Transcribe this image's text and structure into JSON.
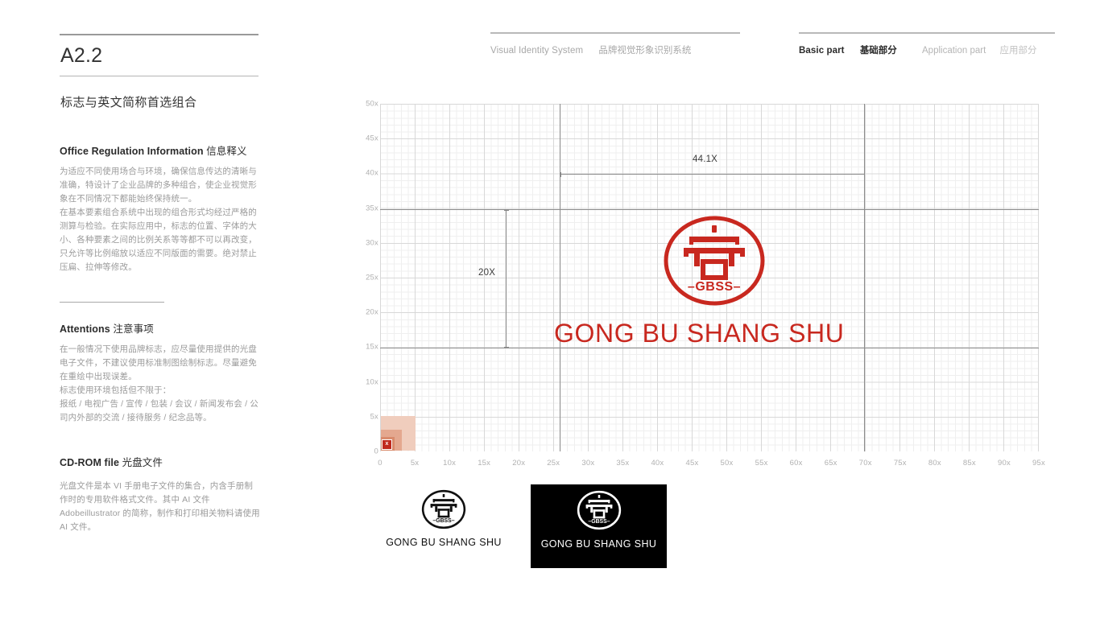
{
  "page": {
    "code": "A2.2",
    "subtitle": "标志与英文简称首选组合"
  },
  "header": {
    "left": {
      "en": "Visual Identity System",
      "cn": "品牌视觉形象识别系统"
    },
    "right": {
      "active_en": "Basic part",
      "active_cn": "基础部分",
      "inactive_en": "Application part",
      "inactive_cn": "应用部分"
    }
  },
  "sections": [
    {
      "heading_en": "Office Regulation Information",
      "heading_cn": "信息释义",
      "paragraphs": [
        "为适应不同使用场合与环境，确保信息传达的清晰与准确，特设计了企业品牌的多种组合，使企业视觉形象在不同情况下都能始终保持统一。",
        "在基本要素组合系统中出现的组合形式均经过严格的测算与检验。在实际应用中，标志的位置、字体的大小、各种要素之间的比例关系等等都不可以再改变，只允许等比例缩放以适应不同版面的需要。绝对禁止压扁、拉伸等修改。"
      ]
    },
    {
      "heading_en": "Attentions",
      "heading_cn": "注意事项",
      "paragraphs": [
        "在一般情况下使用品牌标志，应尽量使用提供的光盘电子文件，不建议使用标准制图绘制标志。尽量避免在重绘中出现误差。",
        "标志使用环境包括但不限于：",
        "报纸 / 电视广告 / 宣传 / 包装 / 会议 / 新闻发布会 / 公司内外部的交流 / 接待服务 / 纪念品等。"
      ]
    },
    {
      "heading_en": "CD-ROM file",
      "heading_cn": "光盘文件",
      "paragraphs": [
        "光盘文件是本 VI 手册电子文件的集合，内含手册制作时的专用软件格式文件。其中 AI 文件 Adobeillustrator 的简称，制作和打印相关物料请使用 AI 文件。"
      ]
    }
  ],
  "chart_data": {
    "type": "scatter",
    "title": "",
    "xlabel": "",
    "ylabel": "",
    "xlim": [
      0,
      95
    ],
    "ylim": [
      0,
      50
    ],
    "grid": true,
    "x_ticks": [
      "0",
      "5x",
      "10x",
      "15x",
      "20x",
      "25x",
      "30x",
      "35x",
      "40x",
      "45x",
      "50x",
      "55x",
      "60x",
      "65x",
      "70x",
      "75x",
      "80x",
      "85x",
      "90x",
      "95x"
    ],
    "x_tick_values": [
      0,
      5,
      10,
      15,
      20,
      25,
      30,
      35,
      40,
      45,
      50,
      55,
      60,
      65,
      70,
      75,
      80,
      85,
      90,
      95
    ],
    "y_ticks": [
      "0",
      "5x",
      "10x",
      "15x",
      "20x",
      "25x",
      "30x",
      "35x",
      "40x",
      "45x",
      "50x"
    ],
    "y_tick_values": [
      0,
      5,
      10,
      15,
      20,
      25,
      30,
      35,
      40,
      45,
      50
    ],
    "minor_grid_step": 1,
    "major_grid_step": 5,
    "reference_lines": [
      {
        "orientation": "horizontal",
        "value": 35
      },
      {
        "orientation": "horizontal",
        "value": 15
      },
      {
        "orientation": "vertical",
        "value": 25
      },
      {
        "orientation": "vertical",
        "value": 70
      }
    ],
    "annotations": [
      {
        "label": "44.1X",
        "orientation": "horizontal",
        "from": 25,
        "to": 70,
        "at": 40
      },
      {
        "label": "20X",
        "orientation": "vertical",
        "from": 15,
        "to": 35,
        "at": 18
      }
    ],
    "unit_swatches": [
      {
        "size": 5,
        "color": "#f0cdbd"
      },
      {
        "size": 3,
        "color": "#e4a88f"
      },
      {
        "size": 2,
        "color": "#d98b6c"
      },
      {
        "size": 1,
        "color": "#c0291d",
        "label": "x"
      }
    ]
  },
  "logo": {
    "ring_label": "GBSS",
    "ring_label_display": "–GBSS–",
    "glyph": "尚",
    "wordmark": "GONG BU SHANG SHU",
    "colors": {
      "primary_red": "#c8281f",
      "black": "#111111",
      "white": "#ffffff"
    }
  },
  "lockups": [
    {
      "name": "mono-black-lockup",
      "wordmark": "GONG BU SHANG SHU",
      "background": "#ffffff",
      "foreground": "#111111"
    },
    {
      "name": "mono-reverse-lockup",
      "wordmark": "GONG BU SHANG SHU",
      "background": "#000000",
      "foreground": "#ffffff"
    }
  ]
}
